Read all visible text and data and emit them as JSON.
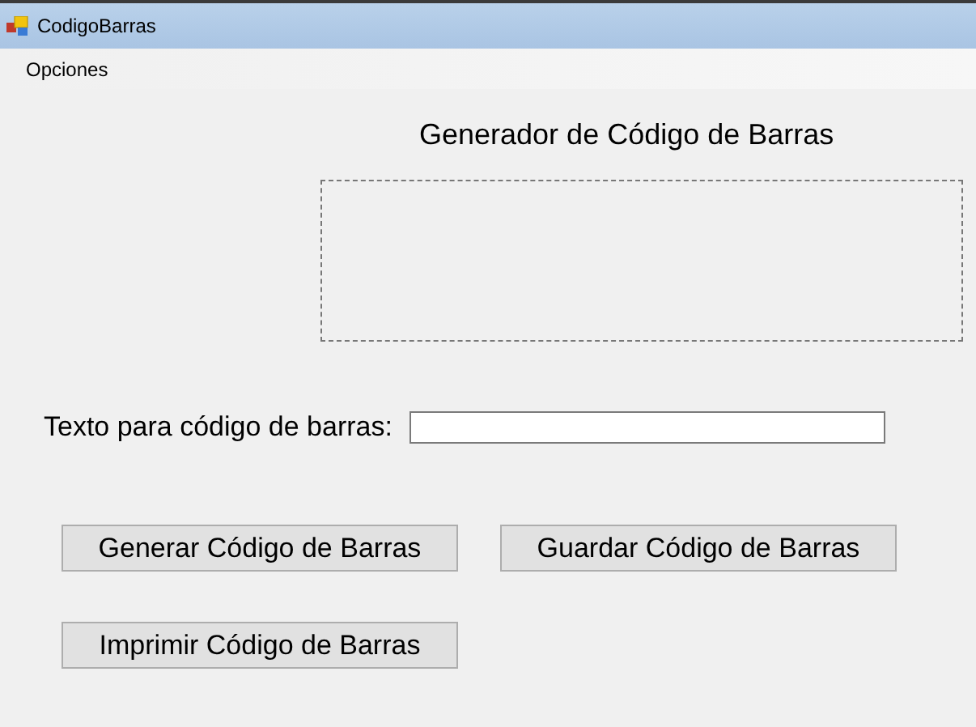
{
  "window": {
    "title": "CodigoBarras"
  },
  "menu": [
    "Opciones"
  ],
  "heading": "Generador de Código de Barras",
  "barcode_area": {
    "empty": true
  },
  "field": {
    "label": "Texto para código de barras:"
  },
  "buttons": [
    "Generar Código de Barras",
    "Guardar Código de Barras",
    "Imprimir Código de Barras"
  ]
}
